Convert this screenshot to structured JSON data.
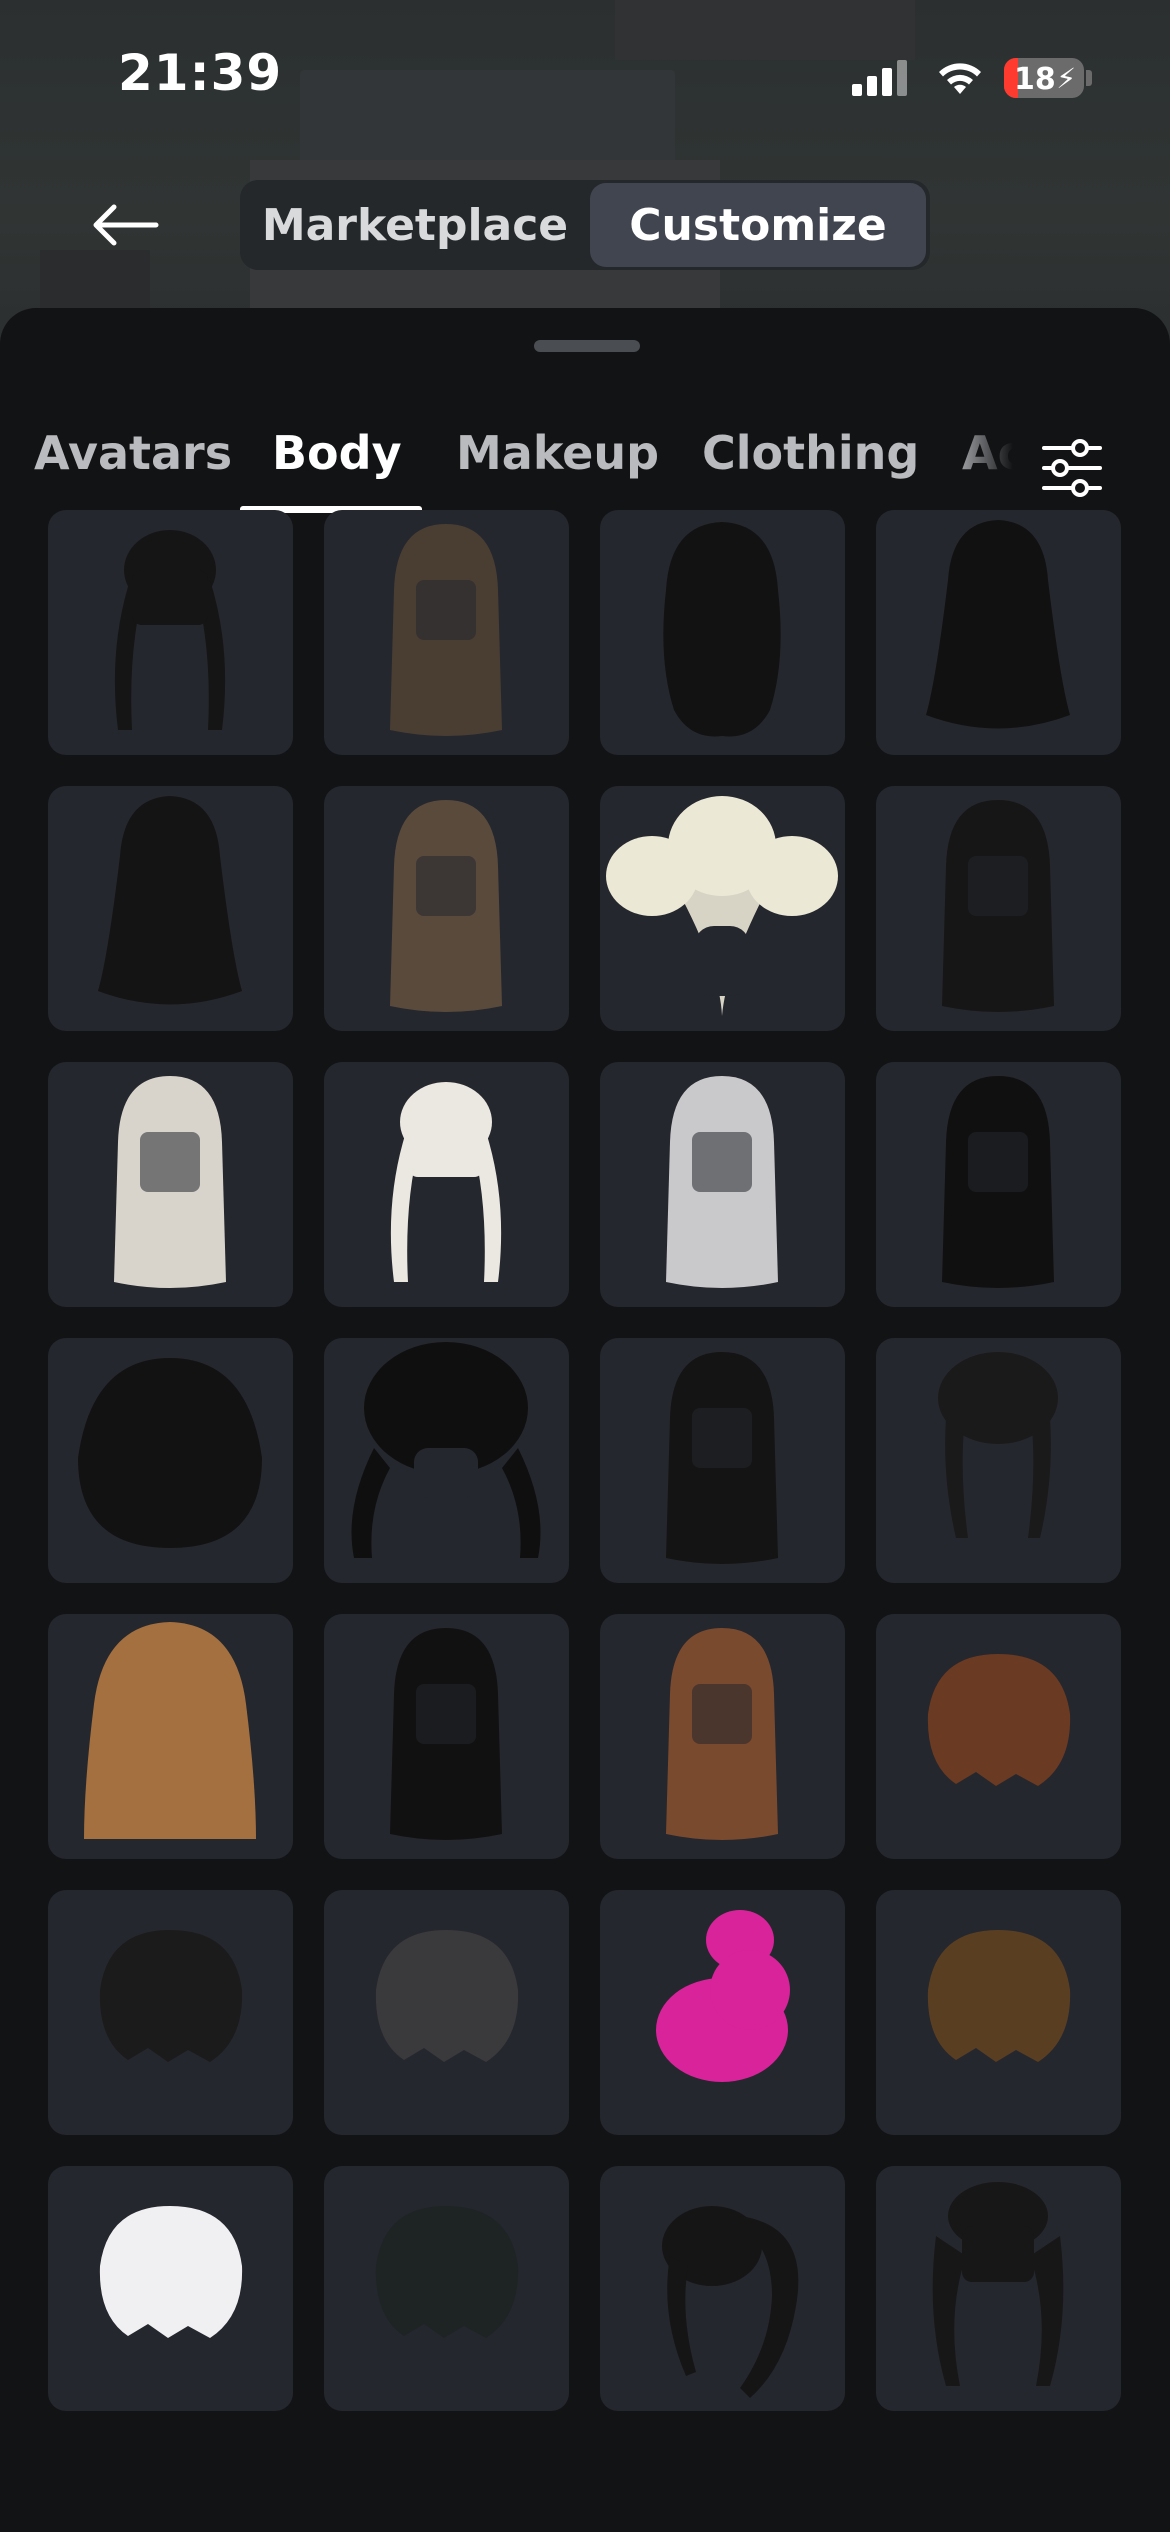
{
  "status_bar": {
    "time": "21:39",
    "battery_percent": "18",
    "battery_level": 0.18,
    "battery_color": "#ff3b30",
    "icons": [
      "cellular-signal-icon",
      "wifi-icon",
      "battery-charging-icon"
    ]
  },
  "header": {
    "back_icon": "arrow-left-icon",
    "segments": [
      "Marketplace",
      "Customize"
    ],
    "selected_segment": "Customize"
  },
  "tabs": {
    "items": [
      "Avatars",
      "Body",
      "Makeup",
      "Clothing",
      "Ac"
    ],
    "active": "Body",
    "filter_icon": "sliders-icon"
  },
  "items": [
    {
      "style": "pigtails",
      "color": "#151515"
    },
    {
      "style": "long-straight",
      "color": "#4a3e33"
    },
    {
      "style": "wavy-long",
      "color": "#121212"
    },
    {
      "style": "long-layered",
      "color": "#111111"
    },
    {
      "style": "long-layered",
      "color": "#141414"
    },
    {
      "style": "long-straight",
      "color": "#5a4a3c"
    },
    {
      "style": "big-pigtails",
      "color": "#ece8d6"
    },
    {
      "style": "long-straight",
      "color": "#161616"
    },
    {
      "style": "long-straight",
      "color": "#d8d4cc"
    },
    {
      "style": "pigtails",
      "color": "#ebe7e1"
    },
    {
      "style": "long-straight",
      "color": "#c9c9cb"
    },
    {
      "style": "long-straight",
      "color": "#101010"
    },
    {
      "style": "bob",
      "color": "#121212"
    },
    {
      "style": "bun-pigtails",
      "color": "#0f0f0f"
    },
    {
      "style": "long-straight",
      "color": "#141414"
    },
    {
      "style": "braids",
      "color": "#1a1a1a"
    },
    {
      "style": "long-wavy",
      "color": "#a4703f"
    },
    {
      "style": "long-straight",
      "color": "#111111"
    },
    {
      "style": "long-straight",
      "color": "#7a4a2e"
    },
    {
      "style": "short-messy",
      "color": "#6b3a22"
    },
    {
      "style": "short-messy",
      "color": "#1b1b1b"
    },
    {
      "style": "short-messy",
      "color": "#3a3a3c"
    },
    {
      "style": "fluffy-pink",
      "color": "#d8239a"
    },
    {
      "style": "short-messy",
      "color": "#5a3e22"
    },
    {
      "style": "short-messy",
      "color": "#f0f0f2"
    },
    {
      "style": "short-messy",
      "color": "#1e2424"
    },
    {
      "style": "ponytail",
      "color": "#151515"
    },
    {
      "style": "updo",
      "color": "#171717"
    }
  ]
}
